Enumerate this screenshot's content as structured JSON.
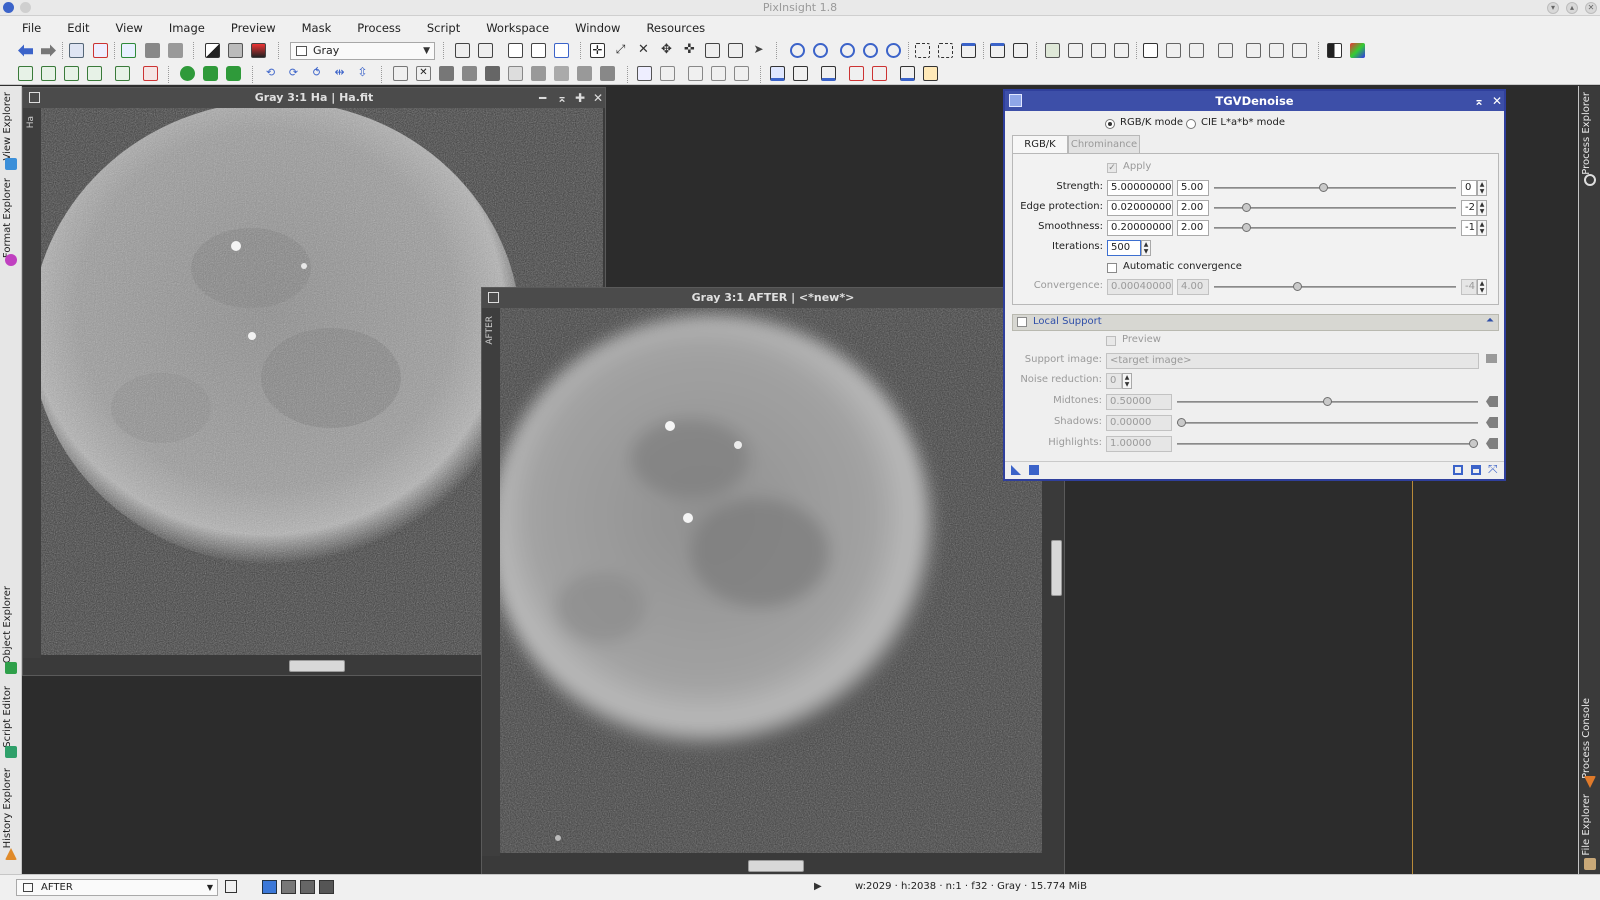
{
  "app": {
    "title": "PixInsight 1.8"
  },
  "menu": [
    "File",
    "Edit",
    "View",
    "Image",
    "Preview",
    "Mask",
    "Process",
    "Script",
    "Workspace",
    "Window",
    "Resources"
  ],
  "toolbar": {
    "channel_select": "Gray"
  },
  "left_panels": [
    "View Explorer",
    "Format Explorer",
    "Object Explorer",
    "Script Editor",
    "History Explorer"
  ],
  "right_panels": [
    "Process Explorer",
    "Process Console",
    "File Explorer"
  ],
  "windows": {
    "ha": {
      "title": "Gray 3:1 Ha | Ha.fit",
      "id": "Ha"
    },
    "after": {
      "title": "Gray 3:1 AFTER | <*new*>",
      "id": "AFTER"
    }
  },
  "dialog": {
    "title": "TGVDenoise",
    "mode_rgbk": "RGB/K mode",
    "mode_lab": "CIE L*a*b* mode",
    "tabs": [
      "RGB/K",
      "Chrominance"
    ],
    "apply_label": "Apply",
    "params": [
      {
        "label": "Strength:",
        "value": "5.00000000",
        "short": "5.00",
        "exp": "0"
      },
      {
        "label": "Edge protection:",
        "value": "0.02000000",
        "short": "2.00",
        "exp": "-2"
      },
      {
        "label": "Smoothness:",
        "value": "0.20000000",
        "short": "2.00",
        "exp": "-1"
      }
    ],
    "iterations_label": "Iterations:",
    "iterations_value": "500",
    "auto_conv_label": "Automatic convergence",
    "convergence": {
      "label": "Convergence:",
      "value": "0.00040000",
      "short": "4.00",
      "exp": "-4"
    },
    "local_support": {
      "title": "Local Support",
      "preview_label": "Preview",
      "support_image_label": "Support image:",
      "support_image_value": "<target image>",
      "noise_reduction_label": "Noise reduction:",
      "noise_reduction_value": "0",
      "midtones": {
        "label": "Midtones:",
        "value": "0.50000"
      },
      "shadows": {
        "label": "Shadows:",
        "value": "0.00000"
      },
      "highlights": {
        "label": "Highlights:",
        "value": "1.00000"
      }
    }
  },
  "slider_levels": {
    "strength": 0.45,
    "edge": 0.12,
    "smooth": 0.12,
    "conv": 0.34,
    "midtones": 0.5,
    "shadows": 0.0,
    "highlights": 1.0
  },
  "statusbar": {
    "view": "AFTER",
    "info": "w:2029 · h:2038 · n:1 · f32 · Gray · 15.774 MiB"
  },
  "colors": {
    "dialog_title": "#3d4fa8",
    "accent": "#2f4fa8",
    "guide": "#b88a3a"
  }
}
